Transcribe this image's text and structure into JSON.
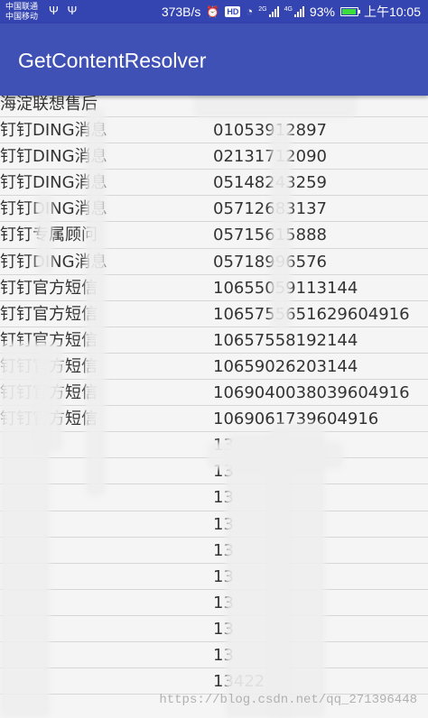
{
  "status_bar": {
    "carrier_1": "中国联通",
    "carrier_2": "中国移动",
    "usb_icons": "Ψ Ψ",
    "network_speed": "373B/s",
    "alarm_icon": "alarm-icon",
    "hd_label": "HD",
    "signal_tag_1": "2G",
    "signal_tag_2": "4G",
    "battery_percent": "93%",
    "time": "上午10:05"
  },
  "app_bar": {
    "title": "GetContentResolver",
    "color": "#3f51b5"
  },
  "contacts": [
    {
      "name": "海淀联想售后",
      "number": ""
    },
    {
      "name": "钉钉DING消息",
      "number": "01053912897"
    },
    {
      "name": "钉钉DING消息",
      "number": "02131712090"
    },
    {
      "name": "钉钉DING消息",
      "number": "05148243259"
    },
    {
      "name": "钉钉DING消息",
      "number": "05712683137"
    },
    {
      "name": "钉钉专属顾问",
      "number": "05715615888"
    },
    {
      "name": "钉钉DING消息",
      "number": "05718996576"
    },
    {
      "name": "钉钉官方短信",
      "number": "10655059113144"
    },
    {
      "name": "钉钉官方短信",
      "number": "1065755651629604916"
    },
    {
      "name": "钉钉官方短信",
      "number": "10657558192144"
    },
    {
      "name": "钉钉官方短信",
      "number": "10659026203144"
    },
    {
      "name": "钉钉官方短信",
      "number": "1069040038039604916"
    },
    {
      "name": "钉钉官方短信",
      "number": "1069061739604916"
    },
    {
      "name": "",
      "number": "13"
    },
    {
      "name": "",
      "number": "13"
    },
    {
      "name": "",
      "number": "13"
    },
    {
      "name": "",
      "number": "13"
    },
    {
      "name": "",
      "number": "13"
    },
    {
      "name": "",
      "number": "13"
    },
    {
      "name": "",
      "number": "13"
    },
    {
      "name": "",
      "number": "13"
    },
    {
      "name": "",
      "number": "13"
    },
    {
      "name": "",
      "number": "13422"
    }
  ],
  "watermark": "https://blog.csdn.net/qq_271396448"
}
